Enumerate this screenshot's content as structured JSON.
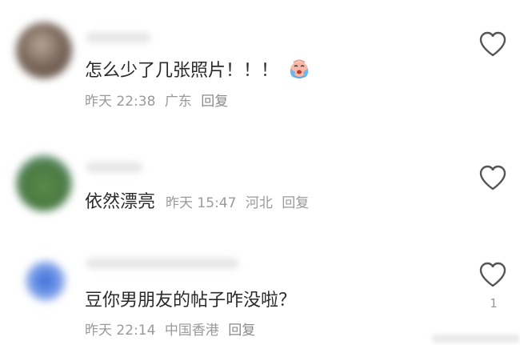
{
  "comments": [
    {
      "text": "怎么少了几张照片！！！",
      "emoji": "crying-face-emoji",
      "time": "昨天 22:38",
      "location": "广东",
      "reply_label": "回复",
      "likes": ""
    },
    {
      "text": "依然漂亮",
      "time": "昨天 15:47",
      "location": "河北",
      "reply_label": "回复",
      "likes": ""
    },
    {
      "text": "豆你男朋友的帖子咋没啦？",
      "time": "昨天 22:14",
      "location": "中国香港",
      "reply_label": "回复",
      "likes": "1"
    }
  ],
  "colors": {
    "text": "#2a2a2a",
    "meta": "#9a9a9a",
    "icon": "#555555"
  }
}
